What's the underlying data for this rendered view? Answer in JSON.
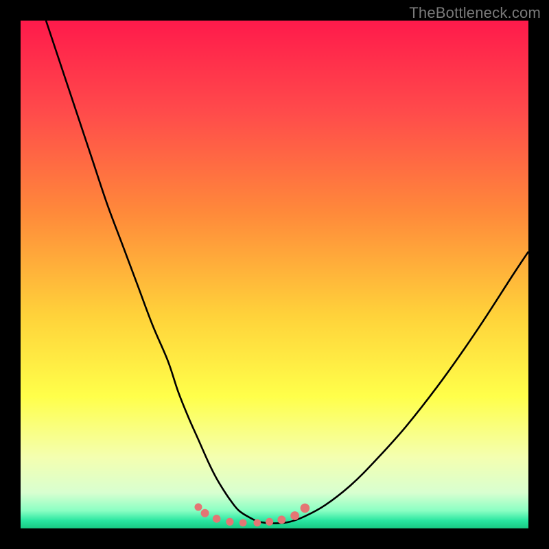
{
  "watermark": {
    "text": "TheBottleneck.com"
  },
  "colors": {
    "gradient_stops": [
      {
        "offset": 0.0,
        "color": "#ff1a4b"
      },
      {
        "offset": 0.18,
        "color": "#ff4b4b"
      },
      {
        "offset": 0.38,
        "color": "#ff8a3a"
      },
      {
        "offset": 0.58,
        "color": "#ffd23a"
      },
      {
        "offset": 0.74,
        "color": "#ffff4a"
      },
      {
        "offset": 0.86,
        "color": "#f4ffb0"
      },
      {
        "offset": 0.93,
        "color": "#d8ffd0"
      },
      {
        "offset": 0.965,
        "color": "#8affc3"
      },
      {
        "offset": 0.985,
        "color": "#28e6a0"
      },
      {
        "offset": 1.0,
        "color": "#18c983"
      }
    ],
    "curve": "#000000",
    "marker": "#e47674"
  },
  "chart_data": {
    "type": "line",
    "title": "",
    "xlabel": "",
    "ylabel": "",
    "xlim": [
      0,
      100
    ],
    "ylim": [
      0,
      100
    ],
    "grid": false,
    "legend": false,
    "series": [
      {
        "name": "bottleneck-curve",
        "x": [
          5,
          8,
          11,
          14,
          17,
          20,
          23,
          26,
          29,
          31,
          33,
          35,
          37,
          38.5,
          40,
          41.5,
          43,
          45,
          47,
          50,
          53,
          56,
          60,
          65,
          70,
          76,
          83,
          90,
          97,
          100
        ],
        "y": [
          100,
          91,
          82,
          73,
          64,
          56,
          48,
          40,
          33,
          27,
          22,
          17.5,
          13,
          10,
          7.5,
          5.3,
          3.5,
          2.2,
          1.3,
          1.0,
          1.3,
          2.4,
          4.6,
          8.5,
          13.5,
          20.2,
          29.2,
          39.2,
          50,
          54.5
        ]
      }
    ],
    "markers": {
      "name": "trough-markers",
      "x": [
        35,
        36.3,
        38.6,
        41.2,
        43.8,
        46.6,
        49,
        51.4,
        54,
        56
      ],
      "y": [
        4.2,
        3.0,
        1.9,
        1.3,
        1.1,
        1.1,
        1.3,
        1.7,
        2.5,
        4.0
      ],
      "r": [
        5.5,
        6.0,
        5.8,
        5.6,
        5.4,
        5.4,
        5.6,
        6.0,
        6.4,
        6.8
      ]
    }
  }
}
